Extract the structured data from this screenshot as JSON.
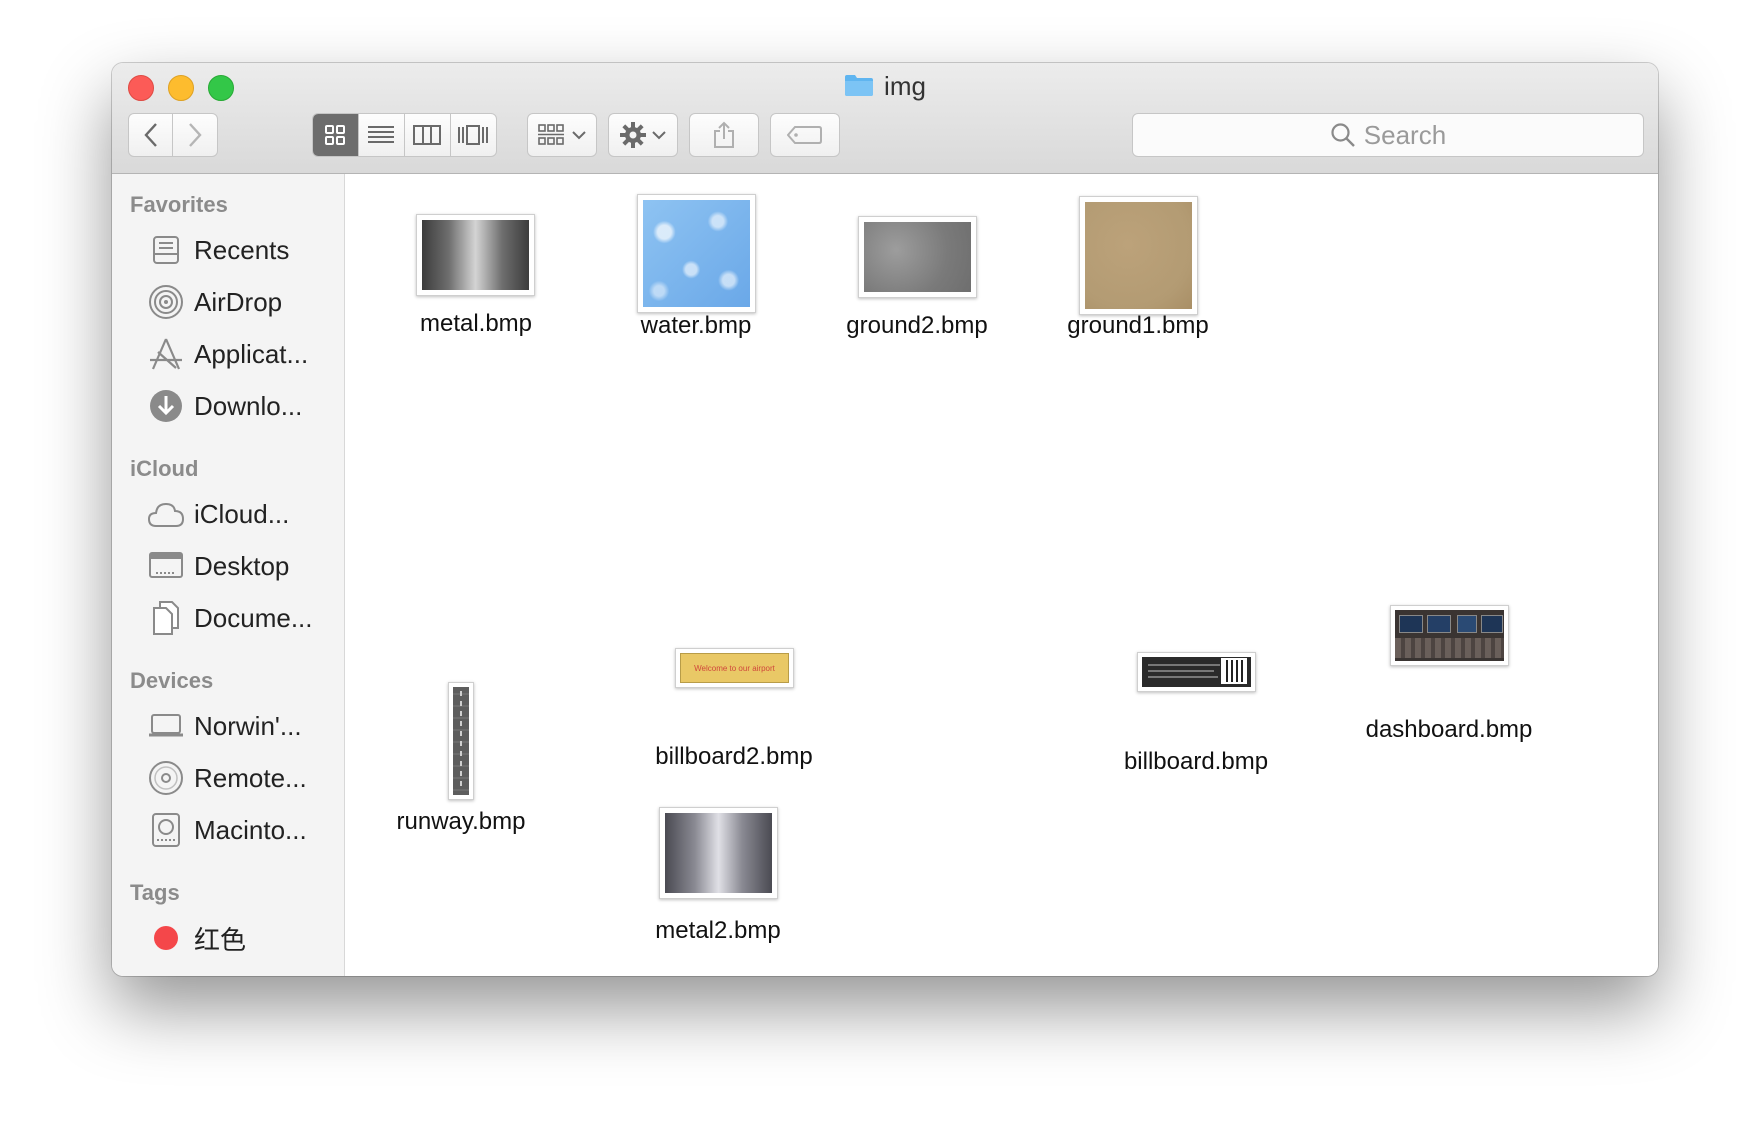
{
  "window": {
    "title": "img"
  },
  "toolbar": {
    "back_icon": "chevron-left-icon",
    "forward_icon": "chevron-right-icon",
    "view_modes": [
      "icon-view",
      "list-view",
      "column-view",
      "cover-flow-view"
    ],
    "active_view": "icon-view",
    "arrange_icon": "grid-arrange-icon",
    "action_icon": "gear-icon",
    "share_icon": "share-icon",
    "tag_icon": "tag-icon",
    "search_placeholder": "Search"
  },
  "sidebar": {
    "sections": [
      {
        "header": "Favorites",
        "items": [
          {
            "label": "Recents",
            "icon": "recents-icon"
          },
          {
            "label": "AirDrop",
            "icon": "airdrop-icon"
          },
          {
            "label": "Applicat...",
            "icon": "applications-icon"
          },
          {
            "label": "Downlo...",
            "icon": "downloads-icon"
          }
        ]
      },
      {
        "header": "iCloud",
        "items": [
          {
            "label": "iCloud...",
            "icon": "cloud-icon"
          },
          {
            "label": "Desktop",
            "icon": "desktop-icon"
          },
          {
            "label": "Docume...",
            "icon": "documents-icon"
          }
        ]
      },
      {
        "header": "Devices",
        "items": [
          {
            "label": "Norwin'...",
            "icon": "laptop-icon"
          },
          {
            "label": "Remote...",
            "icon": "disc-icon"
          },
          {
            "label": "Macinto...",
            "icon": "hard-drive-icon"
          }
        ]
      },
      {
        "header": "Tags",
        "items": [
          {
            "label": "红色",
            "icon": "tag-dot-icon",
            "color": "#f4474a"
          }
        ]
      }
    ]
  },
  "files": [
    {
      "name": "metal.bmp",
      "preview": "brushed-metal"
    },
    {
      "name": "water.bmp",
      "preview": "water-texture"
    },
    {
      "name": "ground2.bmp",
      "preview": "gray-concrete"
    },
    {
      "name": "ground1.bmp",
      "preview": "sand-texture"
    },
    {
      "name": "runway.bmp",
      "preview": "runway-strip"
    },
    {
      "name": "billboard2.bmp",
      "preview": "welcome-billboard",
      "preview_text": "Welcome to our airport"
    },
    {
      "name": "billboard.bmp",
      "preview": "dark-billboard-qr"
    },
    {
      "name": "dashboard.bmp",
      "preview": "cockpit-dashboard"
    },
    {
      "name": "metal2.bmp",
      "preview": "brushed-metal-2"
    }
  ],
  "colors": {
    "close": "#fc5b57",
    "minimize": "#fdbc2e",
    "maximize": "#33c748",
    "folder": "#5fb5f0",
    "sand": "#b39b73",
    "billboard_bg": "#e9c866",
    "billboard_text": "#d0483b",
    "active_segment": "#6d6d6d"
  }
}
